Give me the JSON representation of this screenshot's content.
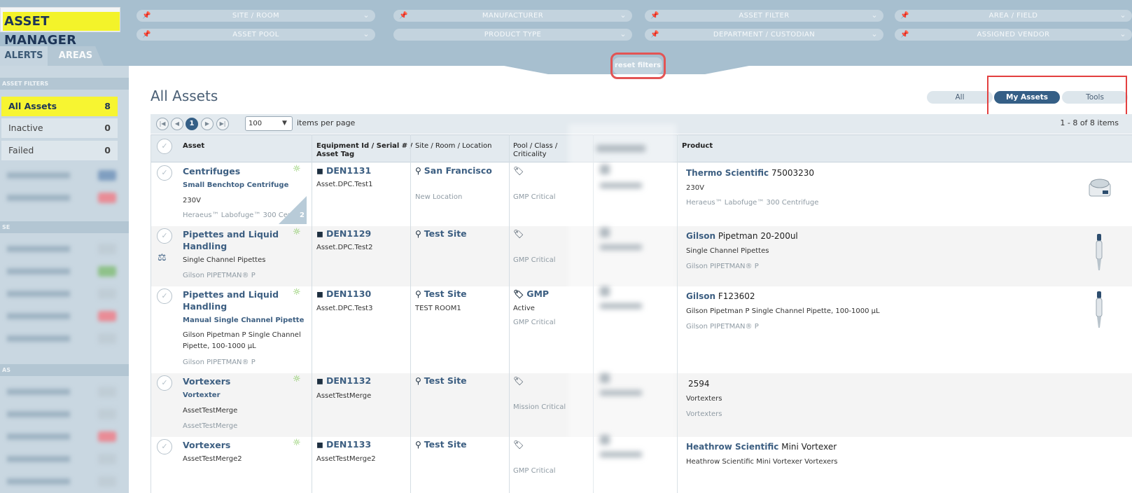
{
  "app": {
    "title": "ASSET MANAGER"
  },
  "filters": {
    "site_room": "SITE / ROOM",
    "manufacturer": "MANUFACTURER",
    "asset_filter": "ASSET FILTER",
    "area_field": "AREA / FIELD",
    "asset_pool": "ASSET POOL",
    "product_type": "PRODUCT TYPE",
    "department": "DEPARTMENT / CUSTODIAN",
    "assigned_vendor": "ASSIGNED VENDOR",
    "reset": "reset filters"
  },
  "tabs": {
    "alerts": "ALERTS",
    "areas": "AREAS"
  },
  "sidebar": {
    "section": "ASSET FILTERS",
    "items": [
      {
        "label": "All Assets",
        "count": "8"
      },
      {
        "label": "Inactive",
        "count": "0"
      },
      {
        "label": "Failed",
        "count": "0"
      }
    ],
    "section2_initial": "SE",
    "section3_initial": "AS"
  },
  "main": {
    "title": "All Assets",
    "segments": {
      "all": "All",
      "mine": "My Assets",
      "tools": "Tools"
    }
  },
  "pager": {
    "first": "|◀",
    "prev": "◀",
    "page": "1",
    "next": "▶",
    "last": "▶|",
    "page_size": "100",
    "items_per_page": "items per page",
    "range": "1 - 8 of 8 items"
  },
  "columns": {
    "asset": "Asset",
    "equipment_line1": "Equipment Id / Serial # /",
    "equipment_line2": "Asset Tag",
    "site": "Site / Room / Location",
    "pool_line1": "Pool / Class /",
    "pool_line2": "Criticality",
    "product": "Product"
  },
  "rows": [
    {
      "name": "Centrifuges",
      "type": "Small Benchtop Centrifuge",
      "desc": "230V",
      "model": "Heraeus™ Labofuge™ 300 Centri",
      "corner_count": "2",
      "id": "DEN1131",
      "tag": "Asset.DPC.Test1",
      "site": "San Francisco",
      "room": "",
      "location": "New Location",
      "pool": "",
      "pool_status": "",
      "criticality": "GMP Critical",
      "manufacturer": "Thermo Scientific",
      "product_name": "75003230",
      "product_desc": "230V",
      "product_model": "Heraeus™ Labofuge™ 300 Centrifuge"
    },
    {
      "name": "Pipettes and Liquid",
      "name2": "Handling",
      "type": "Single Channel Pipettes",
      "model": "Gilson PIPETMAN® P",
      "id": "DEN1129",
      "tag": "Asset.DPC.Test2",
      "site": "Test Site",
      "criticality": "GMP Critical",
      "manufacturer": "Gilson",
      "product_name": "Pipetman 20-200ul",
      "product_desc": "Single Channel Pipettes",
      "product_model": "Gilson PIPETMAN® P"
    },
    {
      "name": "Pipettes and Liquid",
      "name2": "Handling",
      "type": "Manual Single Channel Pipette",
      "desc1": "Gilson Pipetman P Single Channel",
      "desc2": "Pipette, 100-1000 µL",
      "model": "Gilson PIPETMAN® P",
      "id": "DEN1130",
      "tag": "Asset.DPC.Test3",
      "site": "Test Site",
      "room": "TEST ROOM1",
      "pool": "GMP",
      "pool_status": "Active",
      "criticality": "GMP Critical",
      "manufacturer": "Gilson",
      "product_name": "F123602",
      "product_desc": "Gilson Pipetman P Single Channel Pipette, 100-1000 µL",
      "product_model": "Gilson PIPETMAN® P"
    },
    {
      "name": "Vortexers",
      "type": "Vortexter",
      "desc": "AssetTestMerge",
      "model": "AssetTestMerge",
      "id": "DEN1132",
      "tag": "AssetTestMerge",
      "site": "Test Site",
      "criticality": "Mission Critical",
      "product_name": "2594",
      "product_desc": "Vortexters",
      "product_model": "Vortexters"
    },
    {
      "name": "Vortexers",
      "desc": "AssetTestMerge2",
      "id": "DEN1133",
      "tag": "AssetTestMerge2",
      "site": "Test Site",
      "criticality": "GMP Critical",
      "manufacturer": "Heathrow Scientific",
      "product_name": "Mini Vortexer",
      "product_desc": "Heathrow Scientific Mini Vortexer Vortexers"
    }
  ],
  "icons": {
    "pin": "pin-icon",
    "chevron": "chevron-down-icon",
    "check": "check-circle-icon",
    "bulb": "lightbulb-icon",
    "cube": "cube-icon",
    "location": "location-pin-icon",
    "tag": "tag-icon",
    "scale": "scale-icon"
  },
  "colors": {
    "topbar": "#a7bfcf",
    "highlight": "#f3f32a",
    "accent": "#355f86",
    "link": "#3d5f82",
    "annotation": "#e34040"
  }
}
